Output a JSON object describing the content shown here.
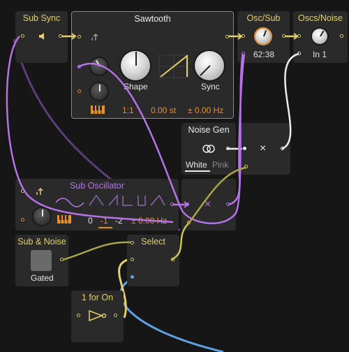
{
  "colors": {
    "background": "#161616",
    "module": "#2a2a2a",
    "yellow": "#e3cf6b",
    "purple": "#b673e8",
    "orange": "#e6902f",
    "white": "#ececec",
    "blue": "#5fa0e0"
  },
  "modules": {
    "sub_sync": {
      "title": "Sub Sync",
      "icon": "speaker-icon"
    },
    "sawtooth": {
      "title": "Sawtooth",
      "shape_label": "Shape",
      "sync_label": "Sync",
      "ratio": "1:1",
      "semitones": "0.00 st",
      "hz": "± 0.00 Hz",
      "icons": [
        "pitch-arrow-icon",
        "keyboard-icon",
        "saw-wave-icon"
      ]
    },
    "osc_sub": {
      "title": "Osc/Sub",
      "value": "62:38"
    },
    "oscs_noise": {
      "title": "Oscs/Noise",
      "value": "In 1"
    },
    "noise_gen": {
      "title": "Noise Gen",
      "icon": "rings-icon",
      "tab_white": "White",
      "tab_pink": "Pink",
      "multiply": "×"
    },
    "sub_oscillator": {
      "title": "Sub Oscillator",
      "octave_options": [
        "0",
        "-1",
        "-2"
      ],
      "selected_octave": "-1",
      "hz": "± 0.00 Hz",
      "multiply": "×"
    },
    "sub_noise": {
      "title": "Sub & Noise",
      "button_label": "Gated"
    },
    "select": {
      "title": "Select"
    },
    "one_for_on": {
      "title": "1 for On",
      "icon": "not-gate-icon"
    }
  }
}
